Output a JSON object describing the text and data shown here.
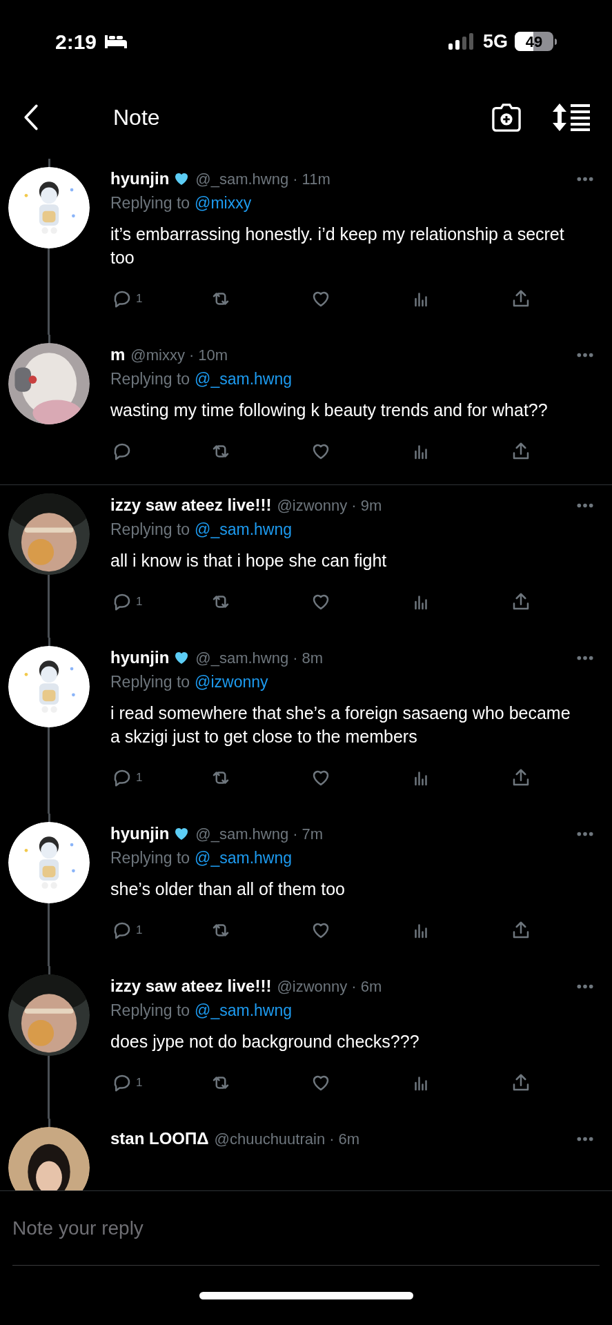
{
  "status_bar": {
    "time": "2:19",
    "network": "5G",
    "battery": "49"
  },
  "header": {
    "title": "Note"
  },
  "tweets": [
    {
      "name": "hyunjin",
      "heart_badge": true,
      "handle": "@_sam.hwng",
      "time": "· 11m",
      "replying_label": "Replying to",
      "replying_to": "@mixxy",
      "text": "it’s embarrassing honestly. i’d keep my relationship a secret too",
      "reply_count": "1",
      "thread_above": true,
      "thread_below": true,
      "divider_below": false
    },
    {
      "name": "m",
      "heart_badge": false,
      "handle": "@mixxy",
      "time": "· 10m",
      "replying_label": "Replying to",
      "replying_to": "@_sam.hwng",
      "text": "wasting my time following k beauty trends and for what??",
      "thread_above": true,
      "thread_below": false,
      "divider_below": true
    },
    {
      "name": "izzy saw ateez live!!!",
      "heart_badge": false,
      "handle": "@izwonny",
      "time": "· 9m",
      "replying_label": "Replying to",
      "replying_to": "@_sam.hwng",
      "text": "all i know is that i hope she can fight",
      "reply_count": "1",
      "thread_above": false,
      "thread_below": true,
      "divider_below": false
    },
    {
      "name": "hyunjin",
      "heart_badge": true,
      "handle": "@_sam.hwng",
      "time": "· 8m",
      "replying_label": "Replying to",
      "replying_to": "@izwonny",
      "text": "i read somewhere that she’s a foreign sasaeng who became a skzigi just to get close to the members",
      "reply_count": "1",
      "thread_above": true,
      "thread_below": true,
      "divider_below": false
    },
    {
      "name": "hyunjin",
      "heart_badge": true,
      "handle": "@_sam.hwng",
      "time": "· 7m",
      "replying_label": "Replying to",
      "replying_to": "@_sam.hwng",
      "text": "she’s older than all of them too",
      "reply_count": "1",
      "thread_above": true,
      "thread_below": true,
      "divider_below": false
    },
    {
      "name": "izzy saw ateez live!!!",
      "heart_badge": false,
      "handle": "@izwonny",
      "time": "· 6m",
      "replying_label": "Replying to",
      "replying_to": "@_sam.hwng",
      "text": "does jype not do background checks???",
      "reply_count": "1",
      "thread_above": true,
      "thread_below": true,
      "divider_below": false
    },
    {
      "name": "stan LOOΠΔ",
      "heart_badge": false,
      "handle": "@chuuchuutrain",
      "time": "· 6m",
      "thread_above": true,
      "thread_below": false,
      "divider_below": false
    }
  ],
  "reply_box": {
    "placeholder": "Note your reply"
  }
}
